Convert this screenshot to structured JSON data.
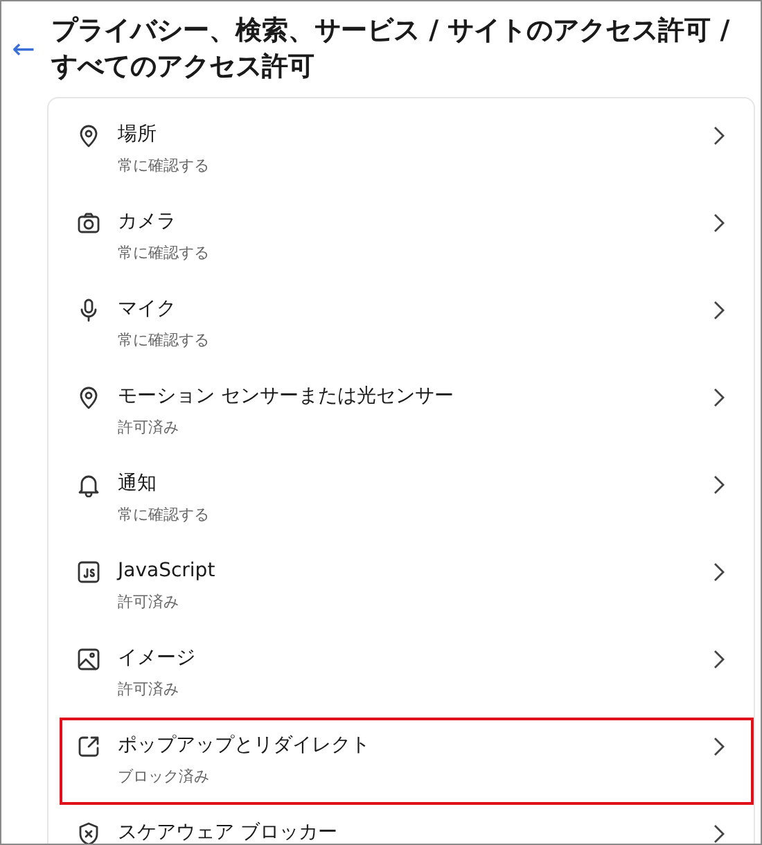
{
  "header": {
    "back": "←",
    "title": "プライバシー、検索、サービス / サイトのアクセス許可 / すべてのアクセス許可"
  },
  "permissions": [
    {
      "label": "場所",
      "status": "常に確認する",
      "highlighted": false
    },
    {
      "label": "カメラ",
      "status": "常に確認する",
      "highlighted": false
    },
    {
      "label": "マイク",
      "status": "常に確認する",
      "highlighted": false
    },
    {
      "label": "モーション センサーまたは光センサー",
      "status": "許可済み",
      "highlighted": false
    },
    {
      "label": "通知",
      "status": "常に確認する",
      "highlighted": false
    },
    {
      "label": "JavaScript",
      "status": "許可済み",
      "highlighted": false
    },
    {
      "label": "イメージ",
      "status": "許可済み",
      "highlighted": false
    },
    {
      "label": "ポップアップとリダイレクト",
      "status": "ブロック済み",
      "highlighted": true
    },
    {
      "label": "スケアウェア ブロッカー",
      "highlighted": false
    }
  ]
}
